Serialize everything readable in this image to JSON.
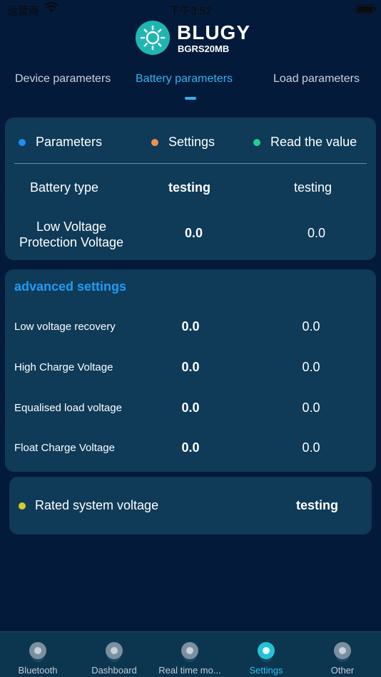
{
  "status_bar": {
    "carrier": "运营商",
    "time": "下午3:52"
  },
  "header": {
    "brand": "BLUGY",
    "model": "BGRS20MB"
  },
  "tabs": [
    {
      "label": "Device parameters",
      "active": false
    },
    {
      "label": "Battery parameters",
      "active": true
    },
    {
      "label": "Load parameters",
      "active": false
    }
  ],
  "legend": [
    {
      "label": "Parameters",
      "color": "#1f8ef1"
    },
    {
      "label": "Settings",
      "color": "#f0904a"
    },
    {
      "label": "Read the value",
      "color": "#1fd18c"
    }
  ],
  "basic_rows": [
    {
      "label": "Battery type",
      "setting": "testing",
      "read": "testing"
    },
    {
      "label_line1": "Low Voltage",
      "label_line2": "Protection Voltage",
      "setting": "0.0",
      "read": "0.0"
    }
  ],
  "advanced": {
    "title": "advanced settings",
    "rows": [
      {
        "label": "Low voltage recovery",
        "setting": "0.0",
        "read": "0.0"
      },
      {
        "label": "High Charge Voltage",
        "setting": "0.0",
        "read": "0.0"
      },
      {
        "label": "Equalised load voltage",
        "setting": "0.0",
        "read": "0.0"
      },
      {
        "label": "Float Charge Voltage",
        "setting": "0.0",
        "read": "0.0"
      }
    ]
  },
  "rated": {
    "label": "Rated system voltage",
    "value": "testing",
    "dot_color": "#d6cc28"
  },
  "bottom_nav": [
    {
      "label": "Bluetooth",
      "icon": "bluetooth-icon",
      "active": false
    },
    {
      "label": "Dashboard",
      "icon": "dashboard-icon",
      "active": false
    },
    {
      "label": "Real time mo...",
      "icon": "realtime-icon",
      "active": false
    },
    {
      "label": "Settings",
      "icon": "settings-icon",
      "active": true
    },
    {
      "label": "Other",
      "icon": "other-icon",
      "active": false
    }
  ]
}
